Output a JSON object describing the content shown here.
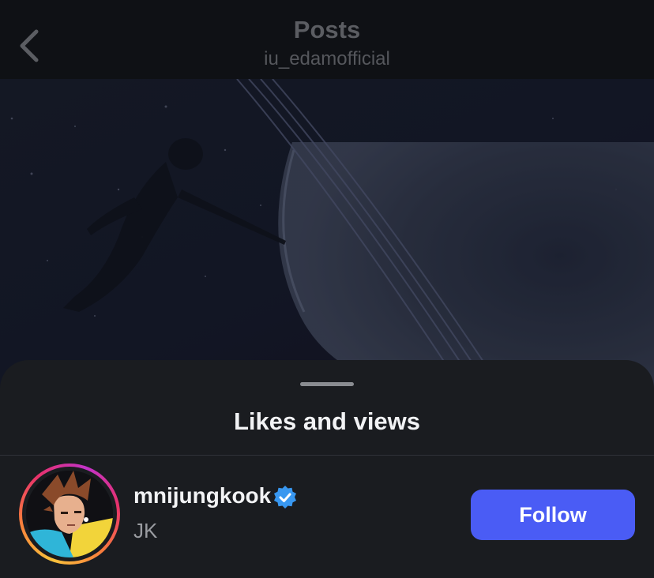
{
  "header": {
    "title": "Posts",
    "subtitle": "iu_edamofficial",
    "back_icon": "chevron-left-icon"
  },
  "post": {
    "image_description_icon": "space-astronaut-planet-image"
  },
  "sheet": {
    "title": "Likes and views"
  },
  "users": [
    {
      "username": "mnijungkook",
      "full_name": "JK",
      "verified": true,
      "follow_label": "Follow"
    }
  ],
  "colors": {
    "accent": "#4a5cf5",
    "verified_badge": "#3897f0",
    "sheet_bg": "#1a1c20"
  }
}
